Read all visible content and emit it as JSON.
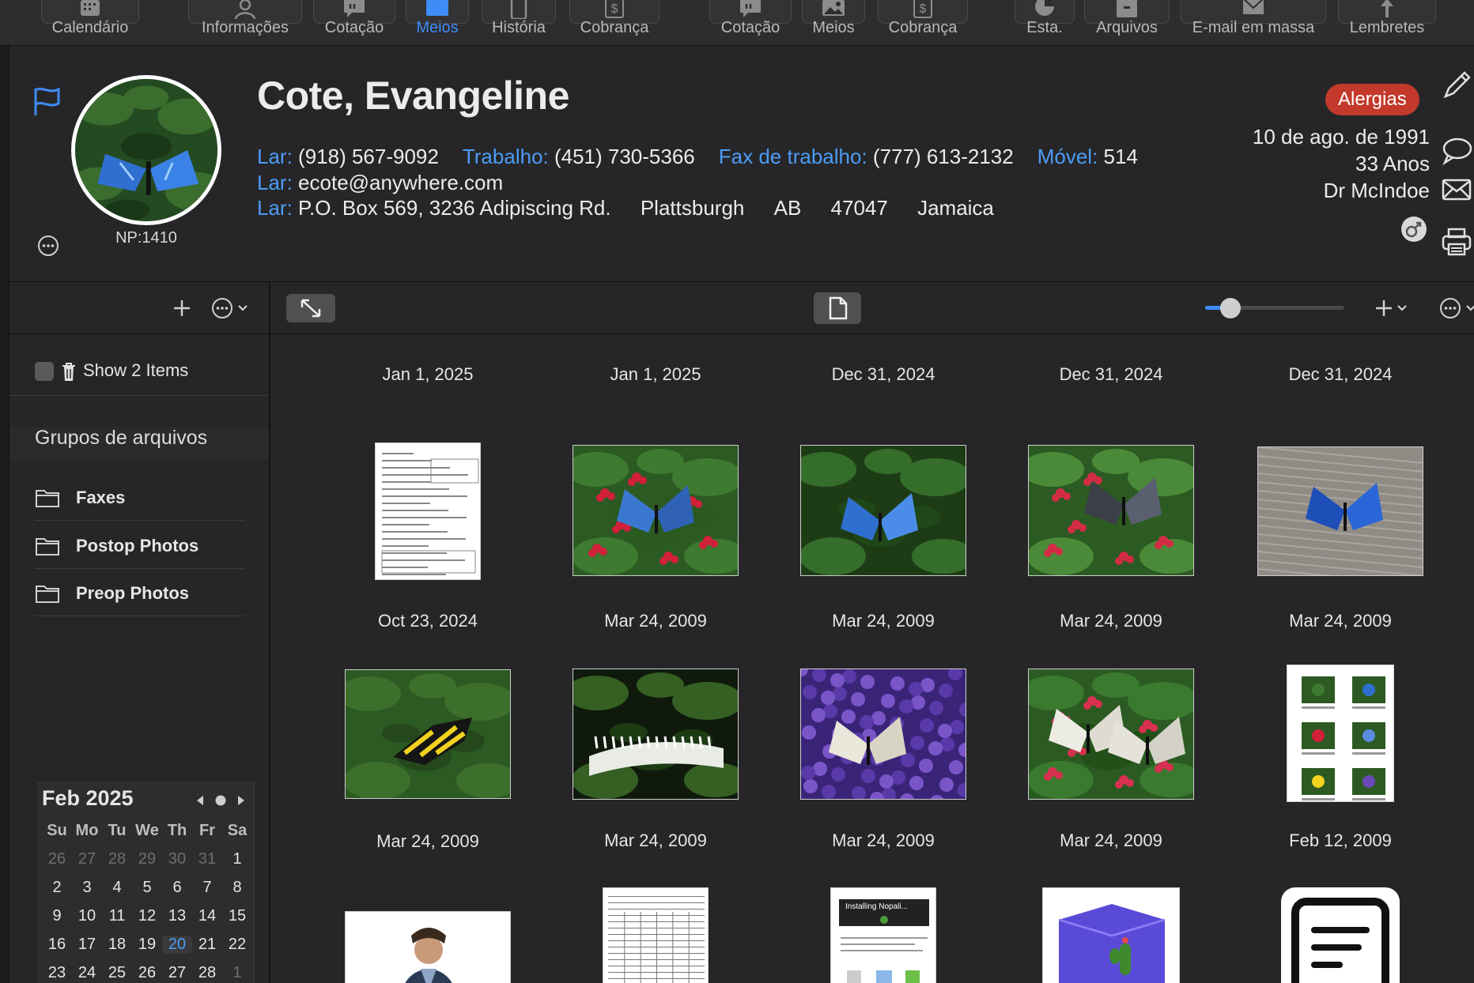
{
  "toolbar": {
    "items": [
      {
        "label": "Calendário",
        "icon": "calendar-icon"
      },
      {
        "label": "Informações",
        "icon": "person-icon"
      },
      {
        "label": "Cotação",
        "icon": "quote-icon"
      },
      {
        "label": "Meios",
        "icon": "photo-icon",
        "active": true
      },
      {
        "label": "História",
        "icon": "document-icon"
      },
      {
        "label": "Cobrança",
        "icon": "billing-icon"
      },
      {
        "label": "Cotação",
        "icon": "quote-icon"
      },
      {
        "label": "Meios",
        "icon": "photo-icon"
      },
      {
        "label": "Cobrança",
        "icon": "billing-icon"
      },
      {
        "label": "Esta.",
        "icon": "pie-chart-icon"
      },
      {
        "label": "Arquivos",
        "icon": "archive-icon"
      },
      {
        "label": "E-mail em massa",
        "icon": "mail-icon"
      },
      {
        "label": "Lembretes",
        "icon": "pin-icon"
      }
    ]
  },
  "patient": {
    "name": "Cote, Evangeline",
    "np": "NP:1410",
    "allergy_badge": "Alergias",
    "dob": "10 de ago. de 1991",
    "age": "33 Anos",
    "doctor": "Dr McIndoe",
    "phones": [
      {
        "label": "Lar:",
        "value": "(918) 567-9092"
      },
      {
        "label": "Trabalho:",
        "value": "(451) 730-5366"
      },
      {
        "label": "Fax de trabalho:",
        "value": "(777) 613-2132"
      },
      {
        "label": "Móvel:",
        "value": "514"
      }
    ],
    "email": {
      "label": "Lar:",
      "value": "ecote@anywhere.com"
    },
    "address": {
      "label": "Lar:",
      "street": "P.O. Box 569, 3236 Adipiscing Rd.",
      "city": "Plattsburgh",
      "region": "AB",
      "postal": "47047",
      "country": "Jamaica"
    }
  },
  "left_panel": {
    "show_items": "Show 2 Items",
    "groups_title": "Grupos de arquivos",
    "groups": [
      "Faxes",
      "Postop Photos",
      "Preop Photos"
    ]
  },
  "calendar": {
    "title": "Feb 2025",
    "weekdays": [
      "Su",
      "Mo",
      "Tu",
      "We",
      "Th",
      "Fr",
      "Sa"
    ],
    "weeks": [
      [
        "26",
        "27",
        "28",
        "29",
        "30",
        "31",
        "1"
      ],
      [
        "2",
        "3",
        "4",
        "5",
        "6",
        "7",
        "8"
      ],
      [
        "9",
        "10",
        "11",
        "12",
        "13",
        "14",
        "15"
      ],
      [
        "16",
        "17",
        "18",
        "19",
        "20",
        "21",
        "22"
      ],
      [
        "23",
        "24",
        "25",
        "26",
        "27",
        "28",
        "1"
      ]
    ],
    "today": "20"
  },
  "media": {
    "zoom_level": 0.18,
    "column_headers": [
      "Jan 1, 2025",
      "Jan 1, 2025",
      "Dec 31, 2024",
      "Dec 31, 2024",
      "Dec 31, 2024"
    ],
    "rows": [
      [
        {
          "date": "Oct 23, 2024",
          "kind": "form-doc",
          "name": "fax-document-thumbnail"
        },
        {
          "date": "Mar 24, 2009",
          "kind": "butterfly-red-flowers",
          "name": "butterfly-photo-thumbnail"
        },
        {
          "date": "Mar 24, 2009",
          "kind": "butterfly-blue-leaves",
          "name": "butterfly-photo-thumbnail"
        },
        {
          "date": "Mar 24, 2009",
          "kind": "butterfly-dark-red",
          "name": "butterfly-photo-thumbnail"
        },
        {
          "date": "Mar 24, 2009",
          "kind": "butterfly-blue-stone",
          "name": "butterfly-photo-thumbnail"
        }
      ],
      [
        {
          "date": "Mar 24, 2009",
          "kind": "butterfly-yellow",
          "name": "butterfly-photo-thumbnail"
        },
        {
          "date": "Mar 24, 2009",
          "kind": "caterpillar",
          "name": "caterpillar-photo-thumbnail"
        },
        {
          "date": "Mar 24, 2009",
          "kind": "butterfly-purple",
          "name": "butterfly-photo-thumbnail"
        },
        {
          "date": "Mar 24, 2009",
          "kind": "butterfly-white-red",
          "name": "butterfly-photo-thumbnail"
        },
        {
          "date": "Feb 12, 2009",
          "kind": "contact-sheet",
          "name": "photo-sheet-thumbnail"
        }
      ],
      [
        {
          "date": "",
          "kind": "person",
          "name": "person-photo-thumbnail"
        },
        {
          "date": "",
          "kind": "table-doc",
          "name": "form-document-thumbnail"
        },
        {
          "date": "",
          "kind": "nopali-doc",
          "name": "installing-nopali-document-thumbnail",
          "caption": "Installing Nopali..."
        },
        {
          "date": "",
          "kind": "nopali-box",
          "name": "nopali-box-thumbnail"
        },
        {
          "date": "",
          "kind": "text-file",
          "name": "text-file-icon"
        }
      ]
    ]
  }
}
